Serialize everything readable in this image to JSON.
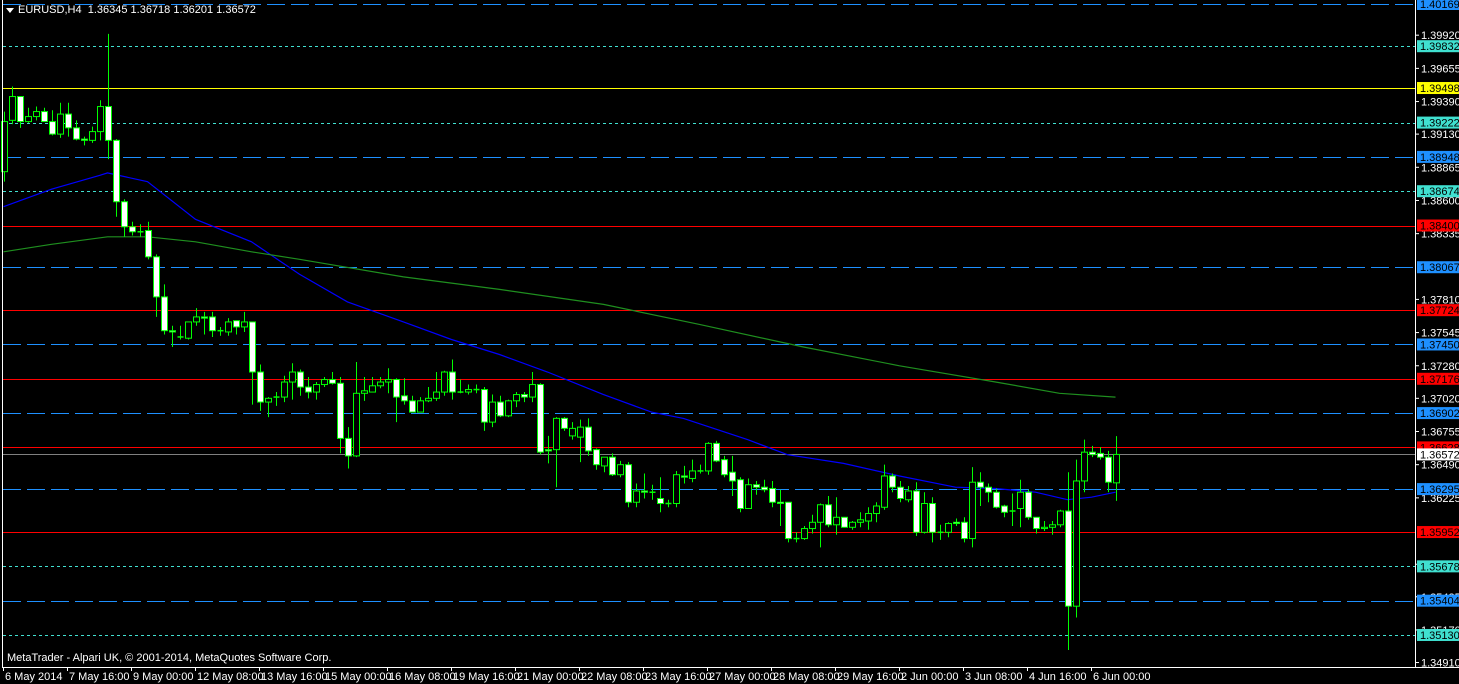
{
  "header": {
    "symbol": "EURUSD,H4",
    "ohlc": "1.36345 1.36718 1.36201 1.36572"
  },
  "copyright": "MetaTrader - Alpari UK, © 2001-2014, MetaQuotes Software Corp.",
  "colors": {
    "background": "#000000",
    "candle_outline": "#00ff00",
    "bear_body": "#ffffff",
    "bull_body": "#000000",
    "ma_fast": "#0000ff",
    "ma_slow": "#1f8f1f",
    "axis": "#ffffff"
  },
  "chart_data": {
    "type": "candlestick",
    "symbol": "EURUSD",
    "timeframe": "H4",
    "ylim": [
      1.3478,
      1.402
    ],
    "price_ticks": [
      "1.39920",
      "1.39655",
      "1.39390",
      "1.39130",
      "1.38865",
      "1.38600",
      "1.38335",
      "1.37810",
      "1.37545",
      "1.37280",
      "1.37020",
      "1.36755",
      "1.36490",
      "1.36225",
      "1.35695",
      "1.35435",
      "1.35170",
      "1.34910"
    ],
    "time_labels": [
      "6 May 2014",
      "7 May 16:00",
      "9 May 00:00",
      "12 May 08:00",
      "13 May 16:00",
      "15 May 00:00",
      "16 May 08:00",
      "19 May 16:00",
      "21 May 00:00",
      "22 May 08:00",
      "23 May 16:00",
      "27 May 00:00",
      "28 May 08:00",
      "29 May 16:00",
      "2 Jun 00:00",
      "3 Jun 08:00",
      "4 Jun 16:00",
      "6 Jun 00:00"
    ],
    "time_label_every_bars": 8,
    "candles_ohlc": [
      [
        1.3883,
        1.3931,
        1.3875,
        1.3923
      ],
      [
        1.3924,
        1.3951,
        1.3921,
        1.3943
      ],
      [
        1.3943,
        1.3943,
        1.3918,
        1.3923
      ],
      [
        1.3923,
        1.3934,
        1.3922,
        1.3927
      ],
      [
        1.3927,
        1.3935,
        1.3924,
        1.3931
      ],
      [
        1.3931,
        1.3934,
        1.3923,
        1.3923
      ],
      [
        1.3923,
        1.3932,
        1.3912,
        1.3913
      ],
      [
        1.3913,
        1.3938,
        1.391,
        1.3929
      ],
      [
        1.3929,
        1.3938,
        1.3911,
        1.3918
      ],
      [
        1.3918,
        1.3924,
        1.3908,
        1.3909
      ],
      [
        1.3909,
        1.3911,
        1.3904,
        1.3908
      ],
      [
        1.3908,
        1.3919,
        1.3906,
        1.3915
      ],
      [
        1.3915,
        1.394,
        1.3908,
        1.3935
      ],
      [
        1.3935,
        1.3993,
        1.3893,
        1.3908
      ],
      [
        1.3908,
        1.3909,
        1.3847,
        1.3859
      ],
      [
        1.3859,
        1.3861,
        1.3831,
        1.3839
      ],
      [
        1.3839,
        1.3843,
        1.3832,
        1.3835
      ],
      [
        1.3835,
        1.3841,
        1.3831,
        1.3835
      ],
      [
        1.3836,
        1.3843,
        1.3813,
        1.3815
      ],
      [
        1.3815,
        1.3817,
        1.3767,
        1.3783
      ],
      [
        1.3783,
        1.3793,
        1.3753,
        1.3756
      ],
      [
        1.3756,
        1.376,
        1.3743,
        1.3755
      ],
      [
        1.3751,
        1.376,
        1.3749,
        1.3751
      ],
      [
        1.375,
        1.3763,
        1.3749,
        1.3763
      ],
      [
        1.3763,
        1.3774,
        1.376,
        1.3767
      ],
      [
        1.3767,
        1.3771,
        1.3753,
        1.3766
      ],
      [
        1.3767,
        1.3771,
        1.3751,
        1.3756
      ],
      [
        1.3756,
        1.3759,
        1.3752,
        1.3756
      ],
      [
        1.3755,
        1.3766,
        1.3752,
        1.3763
      ],
      [
        1.3764,
        1.3764,
        1.3753,
        1.3759
      ],
      [
        1.3759,
        1.3771,
        1.3755,
        1.3763
      ],
      [
        1.3763,
        1.3763,
        1.3697,
        1.3723
      ],
      [
        1.3723,
        1.3729,
        1.3692,
        1.3699
      ],
      [
        1.3699,
        1.3703,
        1.3687,
        1.3702
      ],
      [
        1.3703,
        1.3707,
        1.3696,
        1.3703
      ],
      [
        1.3703,
        1.372,
        1.3699,
        1.3715
      ],
      [
        1.3715,
        1.373,
        1.3701,
        1.3723
      ],
      [
        1.3723,
        1.3725,
        1.3704,
        1.3711
      ],
      [
        1.3711,
        1.3719,
        1.3702,
        1.3707
      ],
      [
        1.3707,
        1.3715,
        1.3701,
        1.3713
      ],
      [
        1.3713,
        1.3719,
        1.3711,
        1.3717
      ],
      [
        1.3717,
        1.3723,
        1.3713,
        1.3714
      ],
      [
        1.3714,
        1.3719,
        1.3658,
        1.367
      ],
      [
        1.367,
        1.3679,
        1.3646,
        1.3656
      ],
      [
        1.3656,
        1.3731,
        1.3655,
        1.3706
      ],
      [
        1.3706,
        1.3719,
        1.37,
        1.3708
      ],
      [
        1.3707,
        1.3719,
        1.3707,
        1.3712
      ],
      [
        1.3712,
        1.3719,
        1.371,
        1.3715
      ],
      [
        1.3715,
        1.3726,
        1.3706,
        1.3717
      ],
      [
        1.3717,
        1.3718,
        1.3683,
        1.3703
      ],
      [
        1.3704,
        1.3718,
        1.3697,
        1.37
      ],
      [
        1.37,
        1.3704,
        1.3691,
        1.3691
      ],
      [
        1.3691,
        1.3703,
        1.3691,
        1.37
      ],
      [
        1.37,
        1.3711,
        1.3699,
        1.3702
      ],
      [
        1.3702,
        1.3723,
        1.37,
        1.3707
      ],
      [
        1.3707,
        1.3724,
        1.3704,
        1.3723
      ],
      [
        1.3723,
        1.3733,
        1.3701,
        1.3707
      ],
      [
        1.3707,
        1.3717,
        1.3706,
        1.3707
      ],
      [
        1.3707,
        1.3713,
        1.3705,
        1.3709
      ],
      [
        1.3709,
        1.3713,
        1.3706,
        1.3709
      ],
      [
        1.3709,
        1.3711,
        1.3676,
        1.3683
      ],
      [
        1.3683,
        1.3705,
        1.3679,
        1.3699
      ],
      [
        1.3699,
        1.3704,
        1.3687,
        1.3688
      ],
      [
        1.3688,
        1.3701,
        1.3687,
        1.37
      ],
      [
        1.37,
        1.3707,
        1.3695,
        1.3705
      ],
      [
        1.3705,
        1.3707,
        1.3699,
        1.3703
      ],
      [
        1.3703,
        1.3723,
        1.3699,
        1.3713
      ],
      [
        1.3713,
        1.3714,
        1.3657,
        1.3659
      ],
      [
        1.3661,
        1.3672,
        1.365,
        1.366
      ],
      [
        1.3661,
        1.3687,
        1.3631,
        1.3686
      ],
      [
        1.3686,
        1.3687,
        1.3676,
        1.3678
      ],
      [
        1.3672,
        1.3683,
        1.3669,
        1.3678
      ],
      [
        1.3671,
        1.3685,
        1.3651,
        1.3679
      ],
      [
        1.3679,
        1.3686,
        1.3656,
        1.366
      ],
      [
        1.3661,
        1.3662,
        1.3645,
        1.3649
      ],
      [
        1.3648,
        1.3655,
        1.3643,
        1.3655
      ],
      [
        1.3655,
        1.3658,
        1.364,
        1.3641
      ],
      [
        1.3641,
        1.3652,
        1.3639,
        1.3649
      ],
      [
        1.3649,
        1.3651,
        1.3615,
        1.3619
      ],
      [
        1.3619,
        1.3634,
        1.3615,
        1.3628
      ],
      [
        1.3628,
        1.3642,
        1.3622,
        1.3627
      ],
      [
        1.3627,
        1.3633,
        1.3621,
        1.3627
      ],
      [
        1.3622,
        1.3639,
        1.3611,
        1.3618
      ],
      [
        1.3618,
        1.3621,
        1.3615,
        1.3618
      ],
      [
        1.3618,
        1.3644,
        1.3615,
        1.3641
      ],
      [
        1.364,
        1.3648,
        1.3634,
        1.3639
      ],
      [
        1.3638,
        1.3653,
        1.3635,
        1.3644
      ],
      [
        1.3644,
        1.3649,
        1.3642,
        1.3644
      ],
      [
        1.3644,
        1.3667,
        1.3641,
        1.3666
      ],
      [
        1.3666,
        1.3668,
        1.3651,
        1.3652
      ],
      [
        1.3653,
        1.3656,
        1.3639,
        1.3641
      ],
      [
        1.3643,
        1.3656,
        1.3624,
        1.3636
      ],
      [
        1.3637,
        1.3639,
        1.3611,
        1.3614
      ],
      [
        1.3614,
        1.3638,
        1.3614,
        1.3633
      ],
      [
        1.3633,
        1.3636,
        1.3625,
        1.3631
      ],
      [
        1.3631,
        1.3637,
        1.3627,
        1.3629
      ],
      [
        1.363,
        1.3636,
        1.3615,
        1.3619
      ],
      [
        1.3619,
        1.3629,
        1.36,
        1.3618
      ],
      [
        1.3619,
        1.3619,
        1.3587,
        1.359
      ],
      [
        1.359,
        1.3595,
        1.3587,
        1.359
      ],
      [
        1.359,
        1.36,
        1.3589,
        1.3598
      ],
      [
        1.3598,
        1.3609,
        1.3594,
        1.3603
      ],
      [
        1.3603,
        1.3618,
        1.3583,
        1.3617
      ],
      [
        1.3617,
        1.3624,
        1.3599,
        1.3601
      ],
      [
        1.3601,
        1.3623,
        1.3593,
        1.3607
      ],
      [
        1.3607,
        1.3607,
        1.3599,
        1.3599
      ],
      [
        1.3599,
        1.3604,
        1.3597,
        1.3603
      ],
      [
        1.3603,
        1.3611,
        1.3599,
        1.3605
      ],
      [
        1.3604,
        1.3615,
        1.3597,
        1.361
      ],
      [
        1.361,
        1.3619,
        1.3603,
        1.3616
      ],
      [
        1.3615,
        1.3649,
        1.3613,
        1.364
      ],
      [
        1.364,
        1.3642,
        1.3627,
        1.3631
      ],
      [
        1.3631,
        1.3636,
        1.3619,
        1.3622
      ],
      [
        1.3621,
        1.3632,
        1.3619,
        1.3628
      ],
      [
        1.3628,
        1.3635,
        1.3592,
        1.3595
      ],
      [
        1.3595,
        1.3627,
        1.3594,
        1.3618
      ],
      [
        1.3618,
        1.3623,
        1.3587,
        1.3595
      ],
      [
        1.3595,
        1.3601,
        1.3589,
        1.3595
      ],
      [
        1.3595,
        1.3603,
        1.3591,
        1.3602
      ],
      [
        1.3603,
        1.3606,
        1.36,
        1.3602
      ],
      [
        1.3603,
        1.3607,
        1.3587,
        1.359
      ],
      [
        1.359,
        1.3647,
        1.3583,
        1.3635
      ],
      [
        1.3635,
        1.3643,
        1.3616,
        1.3631
      ],
      [
        1.3631,
        1.3634,
        1.3619,
        1.3627
      ],
      [
        1.3627,
        1.363,
        1.3614,
        1.3615
      ],
      [
        1.3616,
        1.3617,
        1.3607,
        1.3611
      ],
      [
        1.3612,
        1.3626,
        1.36,
        1.3612
      ],
      [
        1.3614,
        1.3637,
        1.3599,
        1.3627
      ],
      [
        1.3627,
        1.3629,
        1.3605,
        1.3607
      ],
      [
        1.3607,
        1.3607,
        1.3594,
        1.3598
      ],
      [
        1.3598,
        1.3604,
        1.3596,
        1.3599
      ],
      [
        1.3599,
        1.3604,
        1.3593,
        1.3601
      ],
      [
        1.3601,
        1.3613,
        1.3599,
        1.3612
      ],
      [
        1.3612,
        1.3643,
        1.3501,
        1.3536
      ],
      [
        1.3536,
        1.3653,
        1.3527,
        1.3636
      ],
      [
        1.3636,
        1.3669,
        1.3627,
        1.3659
      ],
      [
        1.3659,
        1.3664,
        1.3655,
        1.3657
      ],
      [
        1.3658,
        1.3663,
        1.3653,
        1.3655
      ],
      [
        1.3655,
        1.366,
        1.3627,
        1.3635
      ],
      [
        1.36345,
        1.36718,
        1.36201,
        1.36572
      ]
    ],
    "moving_averages": [
      {
        "color": "#0000ff",
        "points_bar_price": [
          [
            0,
            1.3855
          ],
          [
            6,
            1.3869
          ],
          [
            12,
            1.388
          ],
          [
            13,
            1.3882
          ],
          [
            18,
            1.3875
          ],
          [
            24,
            1.3845
          ],
          [
            31,
            1.3827
          ],
          [
            37,
            1.3801
          ],
          [
            43,
            1.3779
          ],
          [
            50,
            1.3763
          ],
          [
            56,
            1.3749
          ],
          [
            62,
            1.3737
          ],
          [
            68,
            1.3723
          ],
          [
            75,
            1.3705
          ],
          [
            81,
            1.3691
          ],
          [
            85,
            1.3686
          ],
          [
            93,
            1.3669
          ],
          [
            98,
            1.3657
          ],
          [
            105,
            1.365
          ],
          [
            112,
            1.364
          ],
          [
            119,
            1.3631
          ],
          [
            124,
            1.363
          ],
          [
            129,
            1.3627
          ],
          [
            133,
            1.3621
          ],
          [
            136,
            1.3623
          ],
          [
            139,
            1.3627
          ]
        ]
      },
      {
        "color": "#1f8f1f",
        "points_bar_price": [
          [
            0,
            1.3819
          ],
          [
            6,
            1.3825
          ],
          [
            13,
            1.3831
          ],
          [
            18,
            1.3831
          ],
          [
            24,
            1.3827
          ],
          [
            31,
            1.3819
          ],
          [
            37,
            1.3813
          ],
          [
            50,
            1.3799
          ],
          [
            62,
            1.3789
          ],
          [
            75,
            1.3777
          ],
          [
            87,
            1.3761
          ],
          [
            100,
            1.3743
          ],
          [
            112,
            1.3728
          ],
          [
            124,
            1.3715
          ],
          [
            132,
            1.3706
          ],
          [
            139,
            1.3703
          ]
        ]
      }
    ],
    "levels": [
      {
        "price": "1.40169",
        "color": "#1e90ff",
        "style": "dashed"
      },
      {
        "price": "1.39832",
        "color": "#40e0d0",
        "style": "dotted"
      },
      {
        "price": "1.39498",
        "color": "#ffff00",
        "style": "solid"
      },
      {
        "price": "1.39222",
        "color": "#40e0d0",
        "style": "dotted"
      },
      {
        "price": "1.38948",
        "color": "#1e90ff",
        "style": "dashed"
      },
      {
        "price": "1.38674",
        "color": "#40e0d0",
        "style": "dotted"
      },
      {
        "price": "1.38400",
        "color": "#ff0000",
        "style": "solid"
      },
      {
        "price": "1.38067",
        "color": "#1e90ff",
        "style": "dashed"
      },
      {
        "price": "1.37724",
        "color": "#ff0000",
        "style": "solid"
      },
      {
        "price": "1.37450",
        "color": "#1e90ff",
        "style": "dashed"
      },
      {
        "price": "1.37176",
        "color": "#ff0000",
        "style": "solid"
      },
      {
        "price": "1.36902",
        "color": "#1e90ff",
        "style": "dashed"
      },
      {
        "price": "1.36628",
        "color": "#ff0000",
        "style": "solid"
      },
      {
        "price": "1.36295",
        "color": "#1e90ff",
        "style": "dashed"
      },
      {
        "price": "1.35952",
        "color": "#ff0000",
        "style": "solid"
      },
      {
        "price": "1.35678",
        "color": "#40e0d0",
        "style": "dotted"
      },
      {
        "price": "1.35404",
        "color": "#1e90ff",
        "style": "dashed"
      },
      {
        "price": "1.35130",
        "color": "#40e0d0",
        "style": "dotted"
      }
    ],
    "current_price": {
      "price": "1.36572",
      "color": "#ffffff",
      "line_color": "#808080"
    }
  }
}
